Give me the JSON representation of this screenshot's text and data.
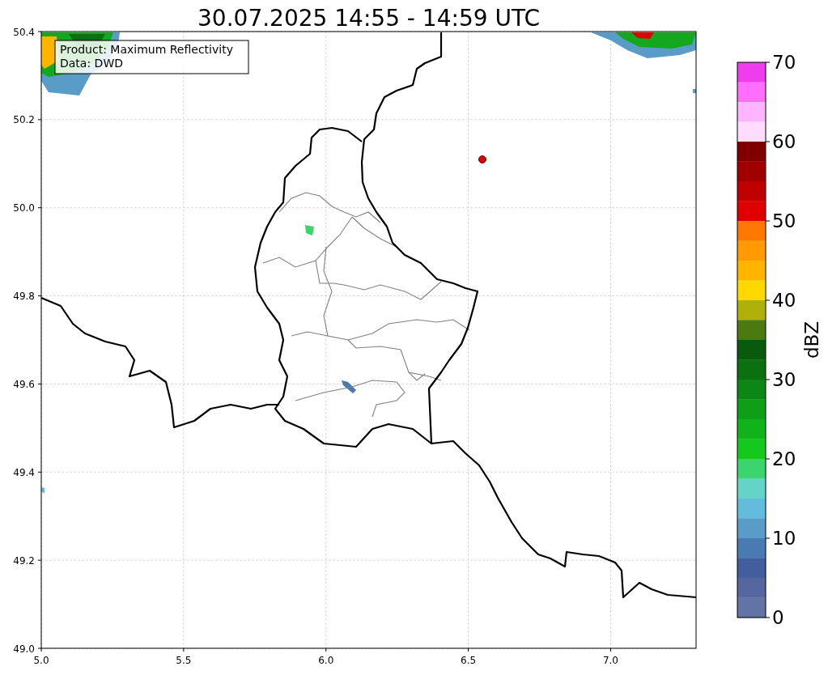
{
  "map": {
    "title": "30.07.2025 14:55 - 14:59 UTC",
    "xticks": [
      "5.0",
      "5.5",
      "6.0",
      "6.5",
      "7.0"
    ],
    "yticks": [
      "50.4",
      "50.2",
      "50.0",
      "49.8",
      "49.6",
      "49.4",
      "49.2",
      "49.0"
    ],
    "annotations": [
      "Product: Maximum Reflectivity",
      "Data: DWD"
    ]
  },
  "colorbar": {
    "label": "dBZ",
    "ticks": [
      "70",
      "60",
      "50",
      "40",
      "30",
      "20",
      "10",
      "0"
    ],
    "bands": [
      {
        "color": "#ee3cee"
      },
      {
        "color": "#ff6eff"
      },
      {
        "color": "#ffb4ff"
      },
      {
        "color": "#ffdcff"
      },
      {
        "color": "#800000"
      },
      {
        "color": "#a00000"
      },
      {
        "color": "#c00000"
      },
      {
        "color": "#e00000"
      },
      {
        "color": "#ff7800"
      },
      {
        "color": "#ff9a00"
      },
      {
        "color": "#ffb400"
      },
      {
        "color": "#ffd800"
      },
      {
        "color": "#b0b00a"
      },
      {
        "color": "#4a7a10"
      },
      {
        "color": "#0a5a0e"
      },
      {
        "color": "#0a7010"
      },
      {
        "color": "#0c8614"
      },
      {
        "color": "#0f9e18"
      },
      {
        "color": "#10b41a"
      },
      {
        "color": "#14c81e"
      },
      {
        "color": "#3cd46e"
      },
      {
        "color": "#64d4c8"
      },
      {
        "color": "#64bcdc"
      },
      {
        "color": "#5a9cc8"
      },
      {
        "color": "#4a7ab2"
      },
      {
        "color": "#435e9e"
      },
      {
        "color": "#5667a0"
      },
      {
        "color": "#6473a6"
      }
    ]
  }
}
